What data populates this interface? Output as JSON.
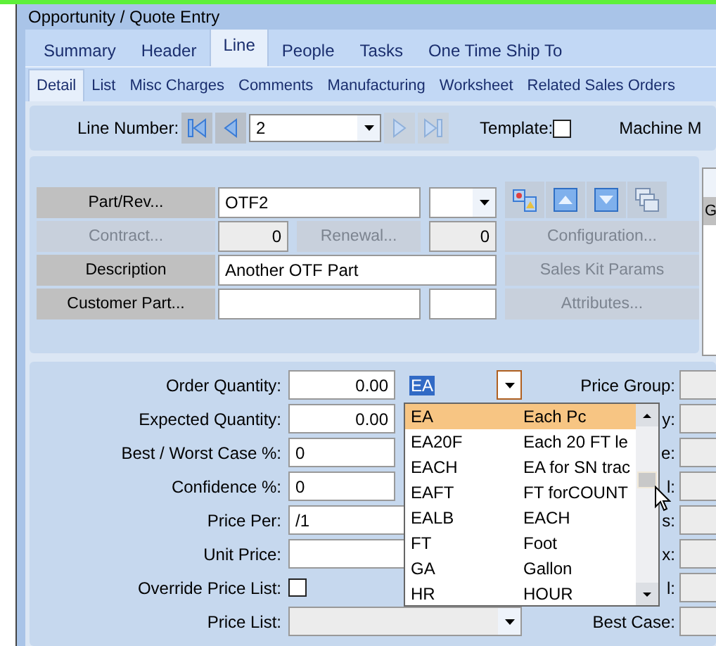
{
  "window": {
    "title": "Opportunity / Quote Entry"
  },
  "tabs": [
    {
      "label": "Summary",
      "selected": false
    },
    {
      "label": "Header",
      "selected": false
    },
    {
      "label": "Line",
      "selected": true
    },
    {
      "label": "People",
      "selected": false
    },
    {
      "label": "Tasks",
      "selected": false
    },
    {
      "label": "One Time Ship To",
      "selected": false
    }
  ],
  "subtabs": [
    {
      "label": "Detail",
      "selected": true
    },
    {
      "label": "List",
      "selected": false
    },
    {
      "label": "Misc Charges",
      "selected": false
    },
    {
      "label": "Comments",
      "selected": false
    },
    {
      "label": "Manufacturing",
      "selected": false
    },
    {
      "label": "Worksheet",
      "selected": false
    },
    {
      "label": "Related Sales Orders",
      "selected": false
    }
  ],
  "line_nav": {
    "label": "Line Number:",
    "value": "2",
    "buttons": [
      {
        "kind": "first",
        "disabled": false
      },
      {
        "kind": "prev",
        "disabled": false
      },
      {
        "kind": "next",
        "disabled": true
      },
      {
        "kind": "last",
        "disabled": true
      }
    ]
  },
  "template": {
    "label": "Template:",
    "checked": false
  },
  "machine_label": "Machine M",
  "part": {
    "part_button": "Part/Rev...",
    "part_value": "OTF2",
    "contract_button": "Contract...",
    "contract_value": "0",
    "renewal_button": "Renewal...",
    "renewal_value": "0",
    "configuration_button": "Configuration...",
    "description_label": "Description",
    "description_value": "Another OTF Part",
    "sales_kit_button": "Sales Kit Params",
    "customer_part_button": "Customer Part...",
    "attributes_button": "Attributes..."
  },
  "grid_header": "G",
  "quantities": [
    {
      "label": "Order Quantity:",
      "kind": "number",
      "value": "0.00"
    },
    {
      "label": "Expected Quantity:",
      "kind": "number",
      "value": "0.00"
    },
    {
      "label": "Best / Worst Case %:",
      "kind": "text",
      "value": "0"
    },
    {
      "label": "Confidence %:",
      "kind": "text",
      "value": "0"
    },
    {
      "label": "Price Per:",
      "kind": "text",
      "value": "/1"
    },
    {
      "label": "Unit Price:",
      "kind": "text"
    },
    {
      "label": "Override Price List:",
      "kind": "checkbox",
      "checked": false
    },
    {
      "label": "Price List:",
      "kind": "combo"
    }
  ],
  "right_labels": [
    "Price Group:",
    "y:",
    "e:",
    "l:",
    "s:",
    "x:",
    "l:",
    "Best Case:"
  ],
  "uom": {
    "value": "EA",
    "options": [
      {
        "code": "EA",
        "description": "Each Pc",
        "selected": true
      },
      {
        "code": "EA20F",
        "description": "Each 20 FT le",
        "selected": false
      },
      {
        "code": "EACH",
        "description": "EA for SN trac",
        "selected": false
      },
      {
        "code": "EAFT",
        "description": "FT forCOUNT",
        "selected": false
      },
      {
        "code": "EALB",
        "description": "EACH",
        "selected": false
      },
      {
        "code": "FT",
        "description": "Foot",
        "selected": false
      },
      {
        "code": "GA",
        "description": "Gallon",
        "selected": false
      },
      {
        "code": "HR",
        "description": "HOUR",
        "selected": false
      }
    ]
  }
}
